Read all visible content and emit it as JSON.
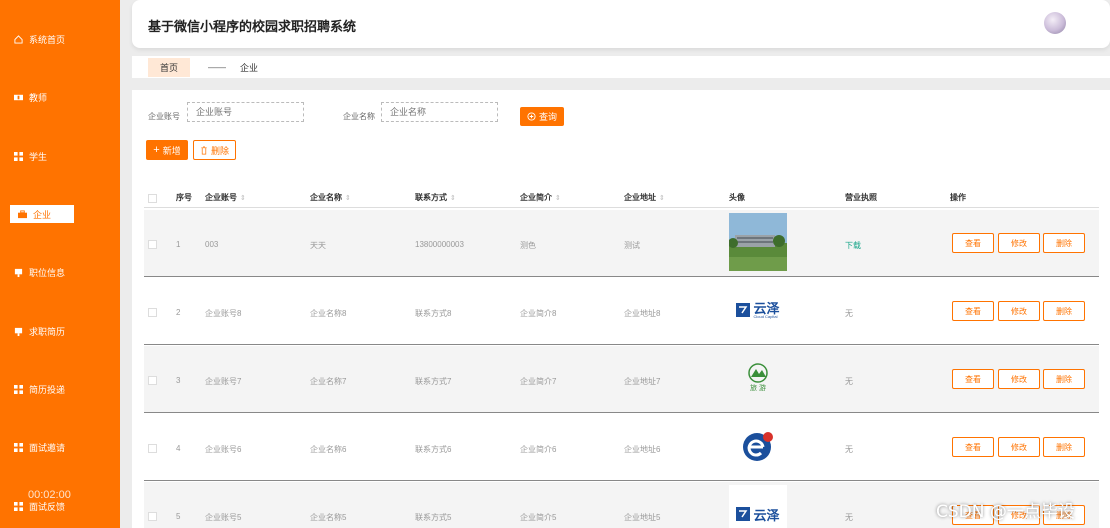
{
  "app": {
    "title": "基于微信小程序的校园求职招聘系统"
  },
  "sidebar": {
    "items": [
      {
        "label": "系统首页",
        "icon": "home-icon"
      },
      {
        "label": "教师",
        "icon": "teacher-icon"
      },
      {
        "label": "学生",
        "icon": "grid-icon"
      },
      {
        "label": "企业",
        "icon": "briefcase-icon",
        "active": true
      },
      {
        "label": "职位信息",
        "icon": "job-icon"
      },
      {
        "label": "求职简历",
        "icon": "resume-icon"
      },
      {
        "label": "简历投递",
        "icon": "grid-icon"
      },
      {
        "label": "面试邀请",
        "icon": "grid-icon"
      },
      {
        "label": "面试反馈",
        "icon": "grid-icon"
      }
    ],
    "video_time": "00:02:00"
  },
  "breadcrumb": {
    "home": "首页",
    "separator": "——",
    "current": "企业"
  },
  "search": {
    "account_label": "企业账号",
    "account_placeholder": "企业账号",
    "name_label": "企业名称",
    "name_placeholder": "企业名称",
    "query_button": "查询"
  },
  "toolbar": {
    "add_button": "新增",
    "delete_button": "删除"
  },
  "table": {
    "headers": {
      "index": "序号",
      "account": "企业账号",
      "name": "企业名称",
      "contact": "联系方式",
      "intro": "企业简介",
      "address": "企业地址",
      "avatar": "头像",
      "license": "营业执照",
      "ops": "操作"
    },
    "rows": [
      {
        "index": "1",
        "account": "003",
        "name": "天天",
        "contact": "13800000003",
        "intro": "测色",
        "address": "测试",
        "license": "下载",
        "image": "campus-photo"
      },
      {
        "index": "2",
        "account": "企业账号8",
        "name": "企业名称8",
        "contact": "联系方式8",
        "intro": "企业简介8",
        "address": "企业地址8",
        "license": "无",
        "image": "yunze-logo"
      },
      {
        "index": "3",
        "account": "企业账号7",
        "name": "企业名称7",
        "contact": "联系方式7",
        "intro": "企业简介7",
        "address": "企业地址7",
        "license": "无",
        "image": "tourism-logo"
      },
      {
        "index": "4",
        "account": "企业账号6",
        "name": "企业名称6",
        "contact": "联系方式6",
        "intro": "企业简介6",
        "address": "企业地址6",
        "license": "无",
        "image": "e-logo"
      },
      {
        "index": "5",
        "account": "企业账号5",
        "name": "企业名称5",
        "contact": "联系方式5",
        "intro": "企业简介5",
        "address": "企业地址5",
        "license": "无",
        "image": "yunze-logo"
      }
    ],
    "actions": {
      "view": "查看",
      "edit": "修改",
      "delete": "删除"
    }
  },
  "logos": {
    "yunze": "云泽",
    "yunze_sub": "Cloud Capital",
    "tourism": "旅 游"
  },
  "watermark": "CSDN @一点毕设",
  "colors": {
    "accent": "#ff7300",
    "download": "#17a589"
  }
}
